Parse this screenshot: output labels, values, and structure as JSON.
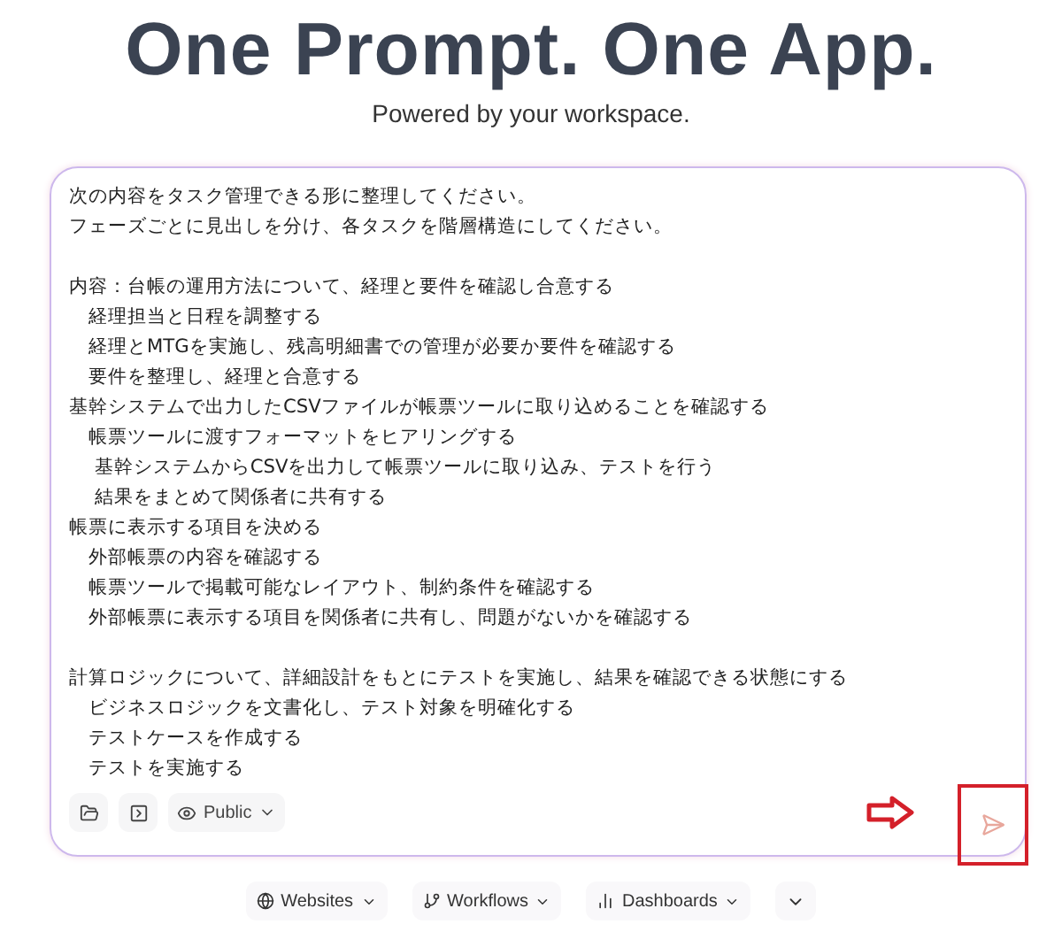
{
  "header": {
    "title": "One Prompt. One App.",
    "subtitle": "Powered by your workspace."
  },
  "prompt": {
    "paragraphs": [
      [
        "次の内容をタスク管理できる形に整理してください。",
        "フェーズごとに見出しを分け、各タスクを階層構造にしてください。"
      ],
      [
        "内容：台帳の運用方法について、経理と要件を確認し合意する",
        "　経理担当と日程を調整する",
        "　経理とMTGを実施し、残高明細書での管理が必要か要件を確認する",
        "　要件を整理し、経理と合意する",
        "基幹システムで出力したCSVファイルが帳票ツールに取り込めることを確認する",
        "　帳票ツールに渡すフォーマットをヒアリングする",
        "　 基幹システムからCSVを出力して帳票ツールに取り込み、テストを行う",
        "　 結果をまとめて関係者に共有する",
        "帳票に表示する項目を決める",
        "　外部帳票の内容を確認する",
        "　帳票ツールで掲載可能なレイアウト、制約条件を確認する",
        "　外部帳票に表示する項目を関係者に共有し、問題がないかを確認する"
      ],
      [
        "計算ロジックについて、詳細設計をもとにテストを実施し、結果を確認できる状態にする",
        "　ビジネスロジックを文書化し、テスト対象を明確化する",
        "　テストケースを作成する",
        "　テストを実施する"
      ]
    ]
  },
  "toolbar": {
    "visibility": "Public"
  },
  "categories": [
    {
      "label": "Websites"
    },
    {
      "label": "Workflows"
    },
    {
      "label": "Dashboards"
    }
  ]
}
